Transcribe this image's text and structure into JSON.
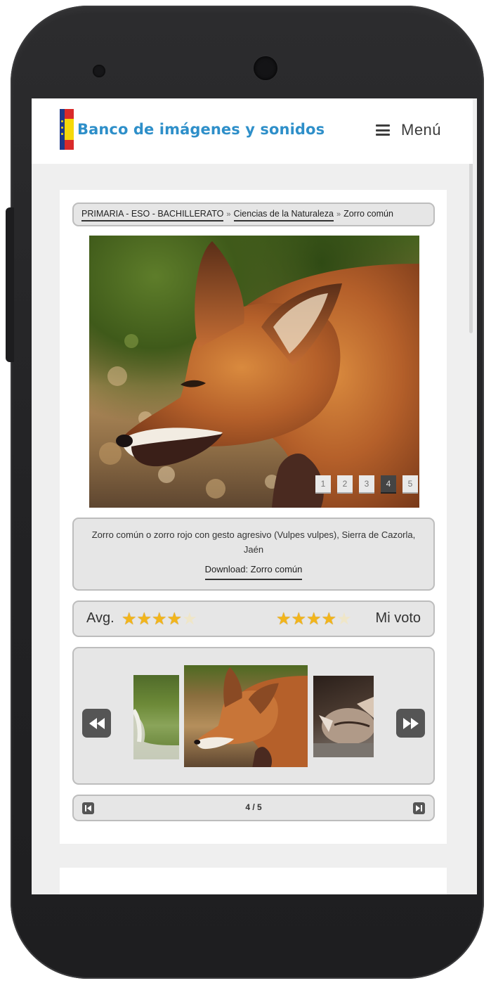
{
  "header": {
    "site_title": "Banco de imágenes y sonidos",
    "menu_label": "Menú",
    "logo_icon": "spain-eu-flag-logo",
    "title_color": "#2e8fc9"
  },
  "breadcrumb": {
    "items": [
      {
        "label": "PRIMARIA - ESO - BACHILLERATO",
        "link": true
      },
      {
        "label": "Ciencias de la Naturaleza",
        "link": true
      },
      {
        "label": "Zorro común",
        "link": false
      }
    ],
    "separator": "»"
  },
  "photo": {
    "subject": "red fox",
    "pages": [
      "1",
      "2",
      "3",
      "4",
      "5"
    ],
    "active_page": 4
  },
  "caption": {
    "text": "Zorro común o zorro rojo con gesto agresivo (Vulpes vulpes), Sierra de Cazorla, Jaén",
    "download_label": "Download: Zorro común"
  },
  "rating": {
    "avg_label": "Avg.",
    "avg_stars": 4,
    "vote_label": "Mi voto",
    "vote_stars": 4,
    "max_stars": 5,
    "star_color": "#f2b51b"
  },
  "carousel": {
    "prev_icon": "rewind-icon",
    "next_icon": "fast-forward-icon",
    "thumbnails": [
      "white-animal-in-grass",
      "red-fox-snarling",
      "fennec-fox-sleeping"
    ]
  },
  "pagination": {
    "counter": "4 / 5",
    "first_icon": "first-page-icon",
    "last_icon": "last-page-icon"
  }
}
